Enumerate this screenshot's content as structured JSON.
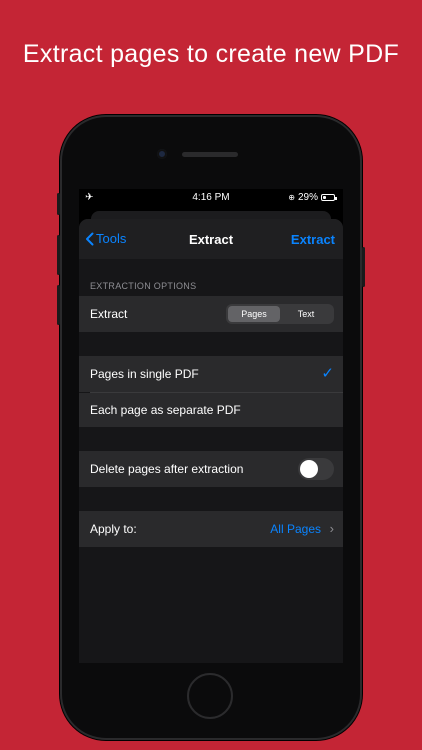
{
  "headline": "Extract pages to create new PDF",
  "status_bar": {
    "time": "4:16 PM",
    "battery": "29%",
    "battery_level": 0.29,
    "icons": [
      "airplane-icon",
      "rotation-lock-icon",
      "battery-icon"
    ]
  },
  "nav": {
    "back_label": "Tools",
    "title": "Extract",
    "action_label": "Extract"
  },
  "extraction_options": {
    "header": "EXTRACTION OPTIONS",
    "extract_label": "Extract",
    "segments": [
      "Pages",
      "Text"
    ],
    "selected_segment": "Pages"
  },
  "output_mode": {
    "options": [
      "Pages in single PDF",
      "Each page as separate PDF"
    ],
    "selected": "Pages in single PDF"
  },
  "delete_after": {
    "label": "Delete pages after extraction",
    "enabled": false
  },
  "apply_to": {
    "label": "Apply to:",
    "value": "All Pages"
  },
  "colors": {
    "background": "#c42535",
    "accent": "#0a84ff",
    "cell": "#2a2a2c",
    "sheet": "#161618"
  }
}
